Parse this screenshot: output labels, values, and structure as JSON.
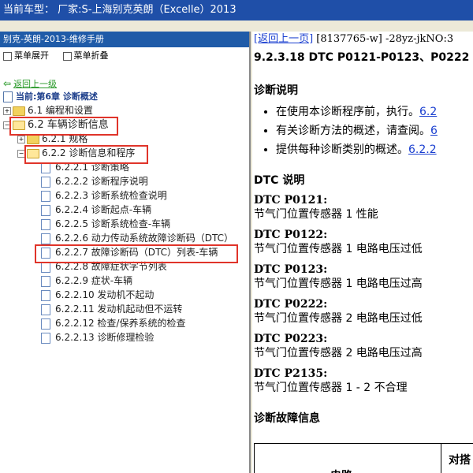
{
  "titlebar": {
    "text": "当前车型： 厂家:S-上海别克英朗（Excelle）2013"
  },
  "left": {
    "header": "别克-英朗-2013-维修手册",
    "toolbar": {
      "expand": "菜单展开",
      "collapse": "菜单折叠"
    },
    "back_link": "返回上一级",
    "current": "当前:第6章 诊断概述",
    "tree": [
      {
        "id": "n61",
        "text": "6.1 编程和设置"
      },
      {
        "id": "n62",
        "text": "6.2 车辆诊断信息"
      },
      {
        "id": "n621",
        "text": "6.2.1 规格"
      },
      {
        "id": "n622",
        "text": "6.2.2 诊断信息和程序"
      },
      {
        "id": "n6221",
        "text": "6.2.2.1 诊断策略"
      },
      {
        "id": "n6222",
        "text": "6.2.2.2 诊断程序说明"
      },
      {
        "id": "n6223",
        "text": "6.2.2.3 诊断系统检查说明"
      },
      {
        "id": "n6224",
        "text": "6.2.2.4 诊断起点-车辆"
      },
      {
        "id": "n6225",
        "text": "6.2.2.5 诊断系统检查-车辆"
      },
      {
        "id": "n6226",
        "text": "6.2.2.6 动力传动系统故障诊断码（DTC）"
      },
      {
        "id": "n6227",
        "text": "6.2.2.7 故障诊断码（DTC）列表-车辆"
      },
      {
        "id": "n6228",
        "text": "6.2.2.8 故障症状字节列表"
      },
      {
        "id": "n6229",
        "text": "6.2.2.9 症状-车辆"
      },
      {
        "id": "n62210",
        "text": "6.2.2.10 发动机不起动"
      },
      {
        "id": "n62211",
        "text": "6.2.2.11 发动机起动但不运转"
      },
      {
        "id": "n62212",
        "text": "6.2.2.12 检查/保养系统的检查"
      },
      {
        "id": "n62213",
        "text": "6.2.2.13 诊断修理检验"
      }
    ]
  },
  "right": {
    "nav_link": "[返回上一页]",
    "nav_rest": " [8137765-w] -28yz-jkNO:3",
    "title": "9.2.3.18 DTC P0121-P0123、P0222",
    "diag_heading": "诊断说明",
    "bullets": [
      {
        "text": "在使用本诊断程序前，执行。",
        "link": "6.2"
      },
      {
        "text": "有关诊断方法的概述，请查阅。",
        "link": "6"
      },
      {
        "text": "提供每种诊断类别的概述。",
        "link": "6.2.2"
      }
    ],
    "dtc_heading": "DTC 说明",
    "dtcs": [
      {
        "code": "DTC P0121:",
        "desc": "节气门位置传感器 1 性能"
      },
      {
        "code": "DTC P0122:",
        "desc": "节气门位置传感器 1 电路电压过低"
      },
      {
        "code": "DTC P0123:",
        "desc": "节气门位置传感器 1 电路电压过高"
      },
      {
        "code": "DTC P0222:",
        "desc": "节气门位置传感器 2 电路电压过低"
      },
      {
        "code": "DTC P0223:",
        "desc": "节气门位置传感器 2 电路电压过高"
      },
      {
        "code": "DTC P2135:",
        "desc": "节气门位置传感器 1 - 2 不合理"
      }
    ],
    "fault_heading": "诊断故障信息",
    "table_col1": "电路",
    "table_col2": "对搭"
  }
}
